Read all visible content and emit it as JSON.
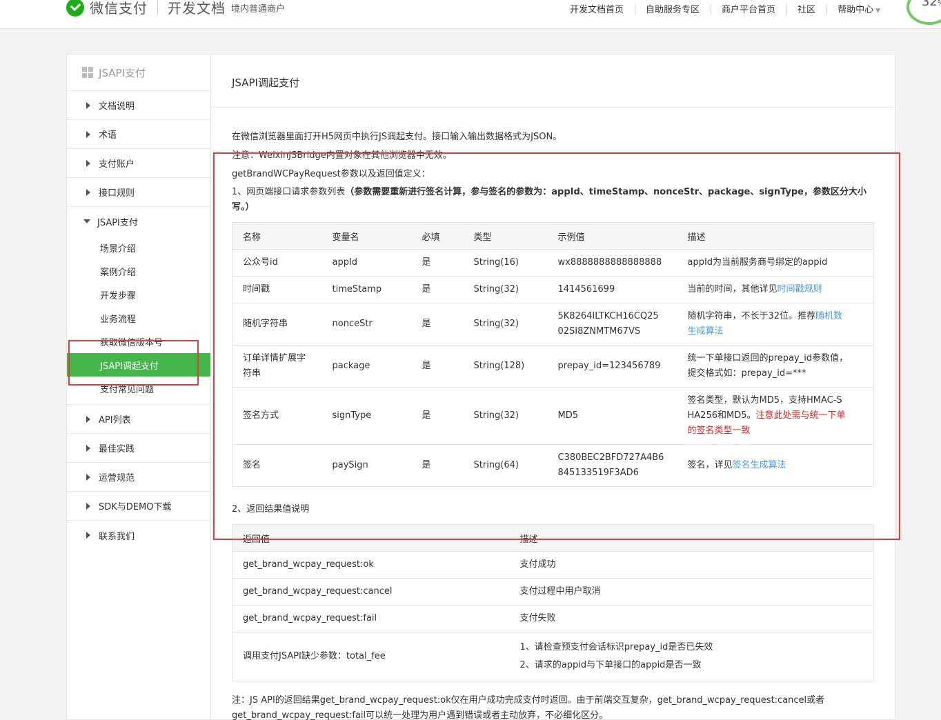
{
  "header": {
    "logo_text": "微信支付",
    "doc_title": "开发文档",
    "doc_subtitle": "境内普通商户",
    "nav": [
      "开发文档首页",
      "自助服务专区",
      "商户平台首页",
      "社区",
      "帮助中心"
    ],
    "progress_badge": "32",
    "progress_unit": "%",
    "colors": {
      "brand_green": "#1aad19",
      "active_green": "#44b549",
      "link_blue": "#459ae9",
      "highlight_red": "#e83a3a"
    }
  },
  "sidebar": {
    "header": "JSAPI支付",
    "items_top": [
      "文档说明",
      "术语",
      "支付账户",
      "接口规则"
    ],
    "open_item": "JSAPI支付",
    "sub_items": [
      "场景介绍",
      "案例介绍",
      "开发步骤",
      "业务流程",
      "获取微信版本号",
      "JSAPI调起支付",
      "支付常见问题"
    ],
    "items_bottom": [
      "API列表",
      "最佳实践",
      "运营规范",
      "SDK与DEMO下载",
      "联系我们"
    ]
  },
  "main": {
    "title": "JSAPI调起支付",
    "intro1": "在微信浏览器里面打开H5网页中执行JS调起支付。接口输入输出数据格式为JSON。",
    "intro2": "注意：WeixinJSBridge内置对象在其他浏览器中无效。",
    "intro3": "getBrandWCPayRequest参数以及返回值定义：",
    "section1_prefix": "1、网页端接口请求参数列表",
    "section1_bold": "（参数需要重新进行签名计算，参与签名的参数为：appId、timeStamp、nonceStr、package、signType，参数区分大小写。）",
    "params_table": {
      "headers": [
        "名称",
        "变量名",
        "必填",
        "类型",
        "示例值",
        "描述"
      ],
      "rows": [
        {
          "name": "公众号id",
          "var": "appId",
          "required": "是",
          "type": "String(16)",
          "example": "wx8888888888888888",
          "desc": "appId为当前服务商号绑定的appid"
        },
        {
          "name": "时间戳",
          "var": "timeStamp",
          "required": "是",
          "type": "String(32)",
          "example": "1414561699",
          "desc": "当前的时间，其他详见",
          "desc_link": "时间戳规则"
        },
        {
          "name": "随机字符串",
          "var": "nonceStr",
          "required": "是",
          "type": "String(32)",
          "example1": "5K8264ILTKCH16CQ25",
          "example2": "02SI8ZNMTM67VS",
          "desc": "随机字符串，不长于32位。推荐",
          "desc_link1": "随机数",
          "desc_link2": "生成算法"
        },
        {
          "name1": "订单详情扩展字",
          "name2": "符串",
          "var": "package",
          "required": "是",
          "type": "String(128)",
          "example": "prepay_id=123456789",
          "desc1": "统一下单接口返回的prepay_id参数值，",
          "desc2": "提交格式如：prepay_id=***"
        },
        {
          "name": "签名方式",
          "var": "signType",
          "required": "是",
          "type": "String(32)",
          "example": "MD5",
          "desc1": "签名类型，默认为MD5，支持HMAC-S",
          "desc2": "HA256和MD5。",
          "desc_red1": "注意此处需与统一下单",
          "desc_red2": "的签名类型一致"
        },
        {
          "name": "签名",
          "var": "paySign",
          "required": "是",
          "type": "String(64)",
          "example1": "C380BEC2BFD727A4B6",
          "example2": "845133519F3AD6",
          "desc": "签名，详见",
          "desc_link": "签名生成算法"
        }
      ]
    },
    "section2": "2、返回结果值说明",
    "result_table": {
      "headers": [
        "返回值",
        "描述"
      ],
      "rows": [
        {
          "value": "get_brand_wcpay_request:ok",
          "desc": "支付成功"
        },
        {
          "value": "get_brand_wcpay_request:cancel",
          "desc": "支付过程中用户取消"
        },
        {
          "value": "get_brand_wcpay_request:fail",
          "desc": "支付失败"
        },
        {
          "value": "调用支付JSAPI缺少参数：total_fee",
          "desc1": "1、请检查预支付会话标识prepay_id是否已失效",
          "desc2": "2、请求的appid与下单接口的appid是否一致"
        }
      ]
    },
    "note": "注：JS API的返回结果get_brand_wcpay_request:ok仅在用户成功完成支付时返回。由于前端交互复杂，get_brand_wcpay_request:cancel或者get_brand_wcpay_request:fail可以统一处理为用户遇到错误或者主动放弃，不必细化区分。"
  }
}
